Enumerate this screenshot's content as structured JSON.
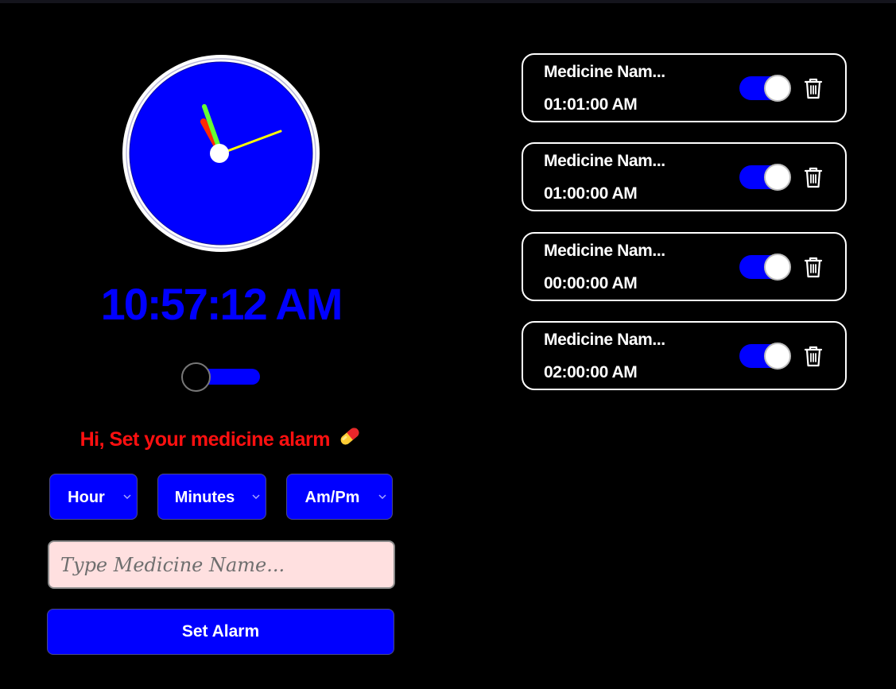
{
  "clock": {
    "face_color": "#0000ff",
    "hour_hand_color": "#ff2a00",
    "minute_hand_color": "#66ff33",
    "second_hand_color": "#ffff00",
    "digital_time": "10:57:12 AM",
    "digital_color": "#0000ff"
  },
  "theme_toggle": {
    "state": "off"
  },
  "greeting": {
    "text": "Hi, Set your medicine alarm",
    "icon": "pill-icon",
    "color": "#ff1010"
  },
  "form": {
    "hour_select": {
      "label": "Hour"
    },
    "minutes_select": {
      "label": "Minutes"
    },
    "ampm_select": {
      "label": "Am/Pm"
    },
    "medicine_input": {
      "value": "",
      "placeholder": "Type Medicine Name..."
    },
    "set_button_label": "Set Alarm"
  },
  "alarms": [
    {
      "name": "Medicine Nam...",
      "time": "01:01:00 AM",
      "enabled": true
    },
    {
      "name": "Medicine Nam...",
      "time": "01:00:00 AM",
      "enabled": true
    },
    {
      "name": "Medicine Nam...",
      "time": "00:00:00 AM",
      "enabled": true
    },
    {
      "name": "Medicine Nam...",
      "time": "02:00:00 AM",
      "enabled": true
    }
  ],
  "accent_color": "#0000ff"
}
